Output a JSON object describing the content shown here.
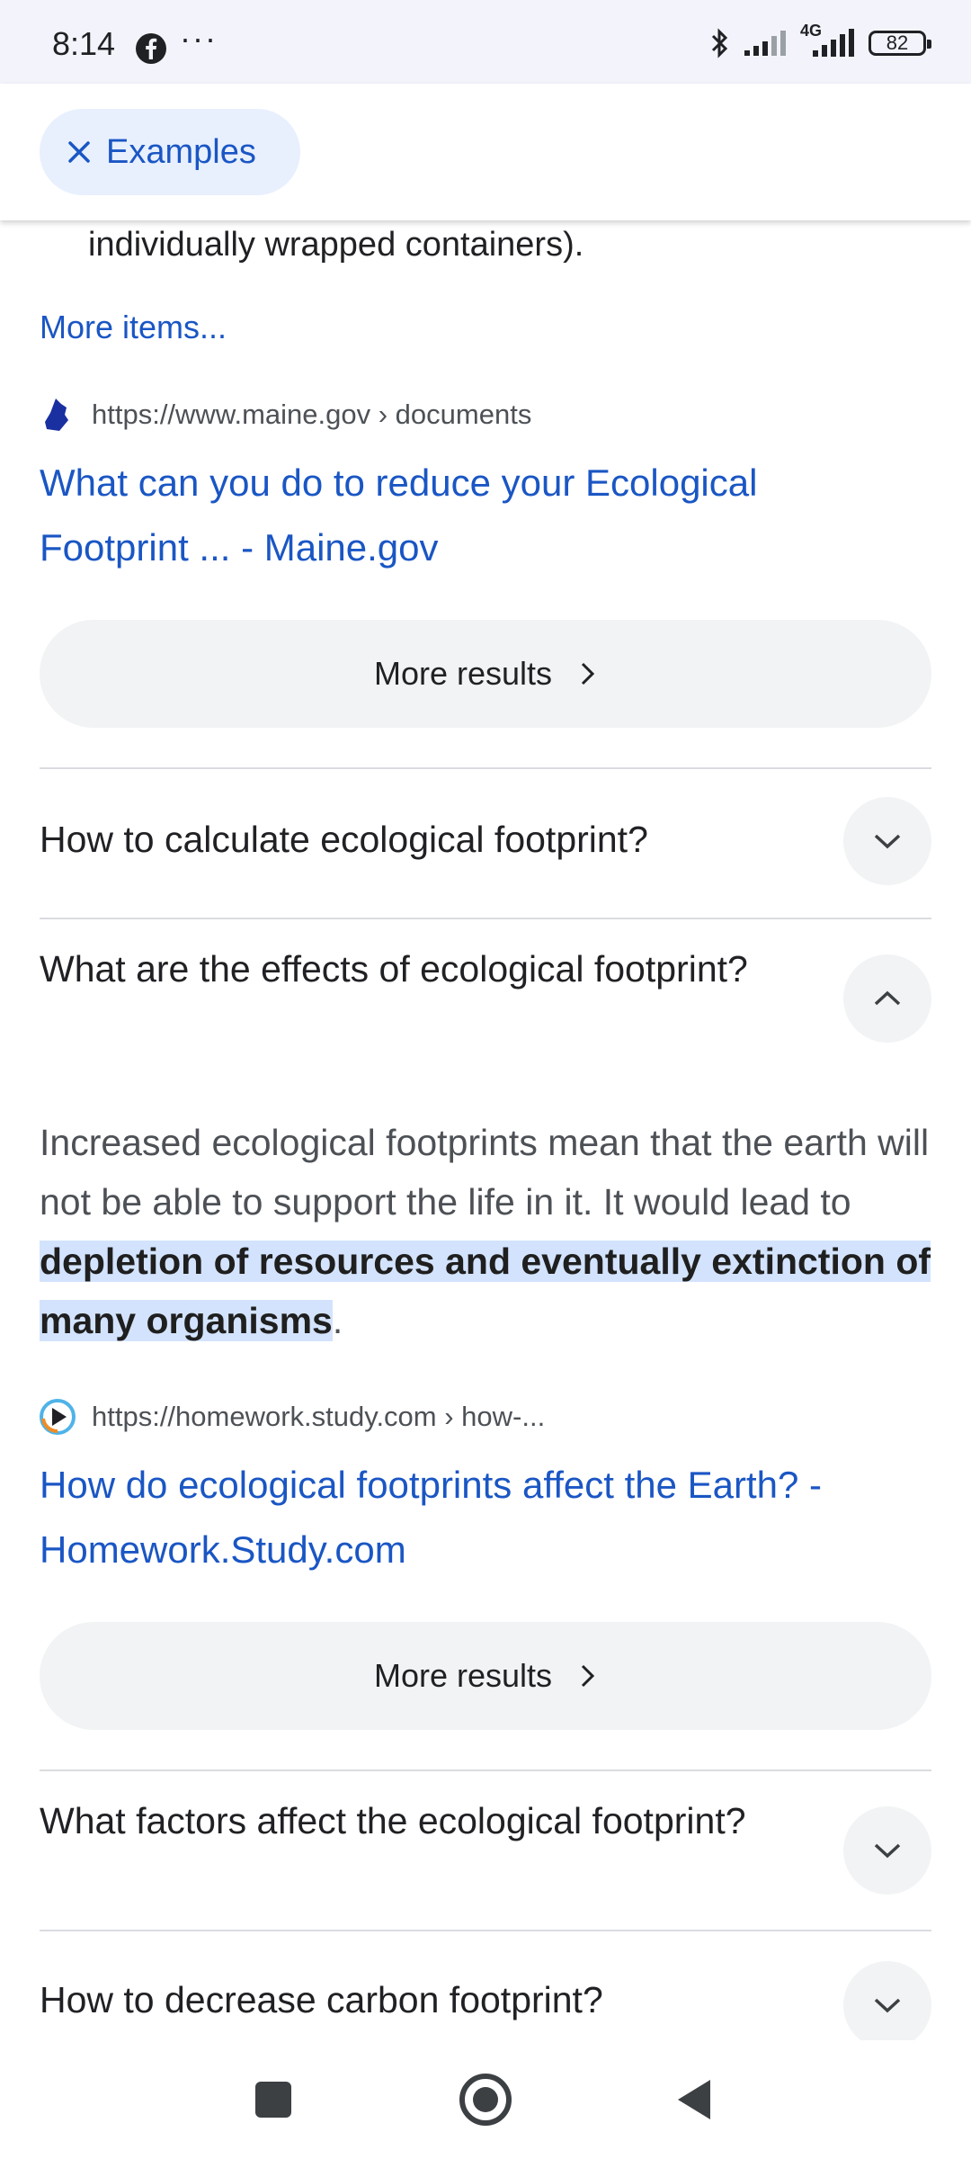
{
  "status": {
    "time": "8:14",
    "more": "···",
    "network": "4G",
    "battery": "82"
  },
  "top_bar": {
    "chip_label": "Examples"
  },
  "results": {
    "cut_text": "individually wrapped containers).",
    "more_items": "More items...",
    "r1": {
      "source": "https://www.maine.gov › documents",
      "title": "What can you do to reduce your Ecological Footprint ... - Maine.gov"
    },
    "more_results": "More results",
    "r2": {
      "source": "https://homework.study.com › how-...",
      "title": "How do ecological footprints affect the Earth? - Homework.Study.com"
    }
  },
  "faq": {
    "q1": "How to calculate ecological footprint?",
    "q2": "What are the effects of ecological footprint?",
    "answer_plain": "Increased ecological footprints mean that the earth will not be able to support the life in it. It would lead to ",
    "answer_highlight": "depletion of resources and eventually extinction of many organisms",
    "answer_end": ".",
    "q3": "What factors affect the ecological footprint?",
    "q4": "How to decrease carbon footprint?"
  },
  "colors": {
    "link": "#1a56c4",
    "highlight": "#d3e3fd",
    "chip_bg": "#e8f0fe"
  }
}
